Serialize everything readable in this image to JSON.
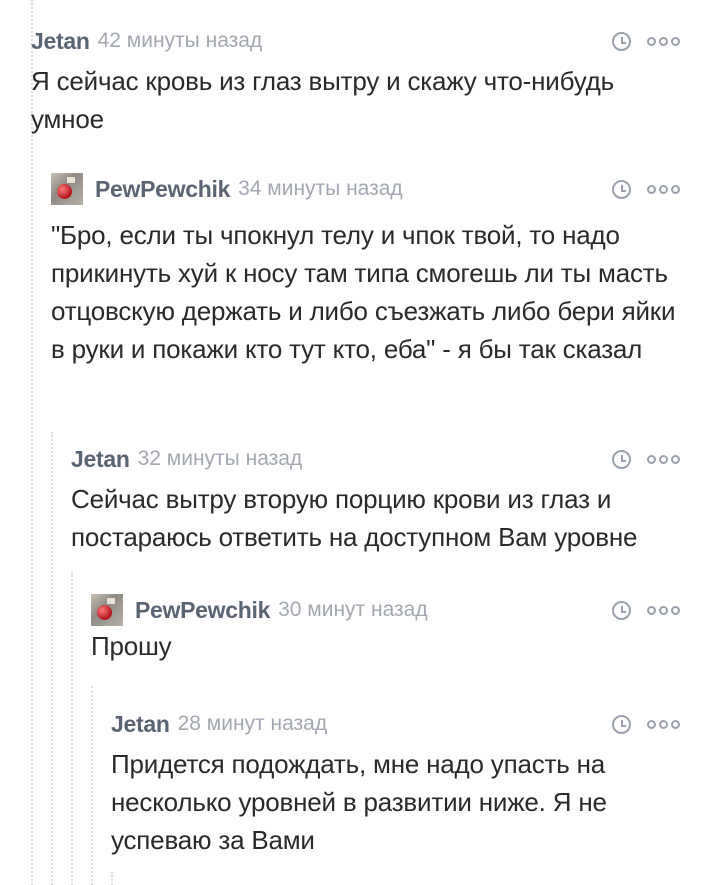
{
  "comments": [
    {
      "author": "Jetan",
      "time": "42 минуты назад",
      "text": "Я сейчас кровь из глаз вытру и скажу что-нибудь умное",
      "has_avatar": false
    },
    {
      "author": "PewPewchik",
      "time": "34 минуты назад",
      "text": "\"Бро, если ты чпокнул телу и чпок твой, то надо прикинуть хуй к носу там типа смогешь ли ты масть отцовскую держать и либо съезжать либо бери яйки в руки и покажи кто тут кто, еба\" - я бы так сказал",
      "has_avatar": true
    },
    {
      "author": "Jetan",
      "time": "32 минуты назад",
      "text": "Сейчас вытру вторую порцию крови из глаз и постараюсь ответить на доступном Вам уровне",
      "has_avatar": false
    },
    {
      "author": "PewPewchik",
      "time": "30 минут назад",
      "text": "Прошу",
      "has_avatar": true
    },
    {
      "author": "Jetan",
      "time": "28 минут назад",
      "text": "Придется подождать, мне надо упасть на несколько уровней в развитии ниже. Я не успеваю за Вами",
      "has_avatar": false
    }
  ],
  "icons": {
    "time": "clock-icon",
    "more": "more-dots-icon"
  },
  "colors": {
    "author": "#5b6472",
    "time": "#a3a8b0",
    "text": "#2a2a2a",
    "thread_line": "#dcdcdc",
    "icon": "#9aa1aa"
  }
}
